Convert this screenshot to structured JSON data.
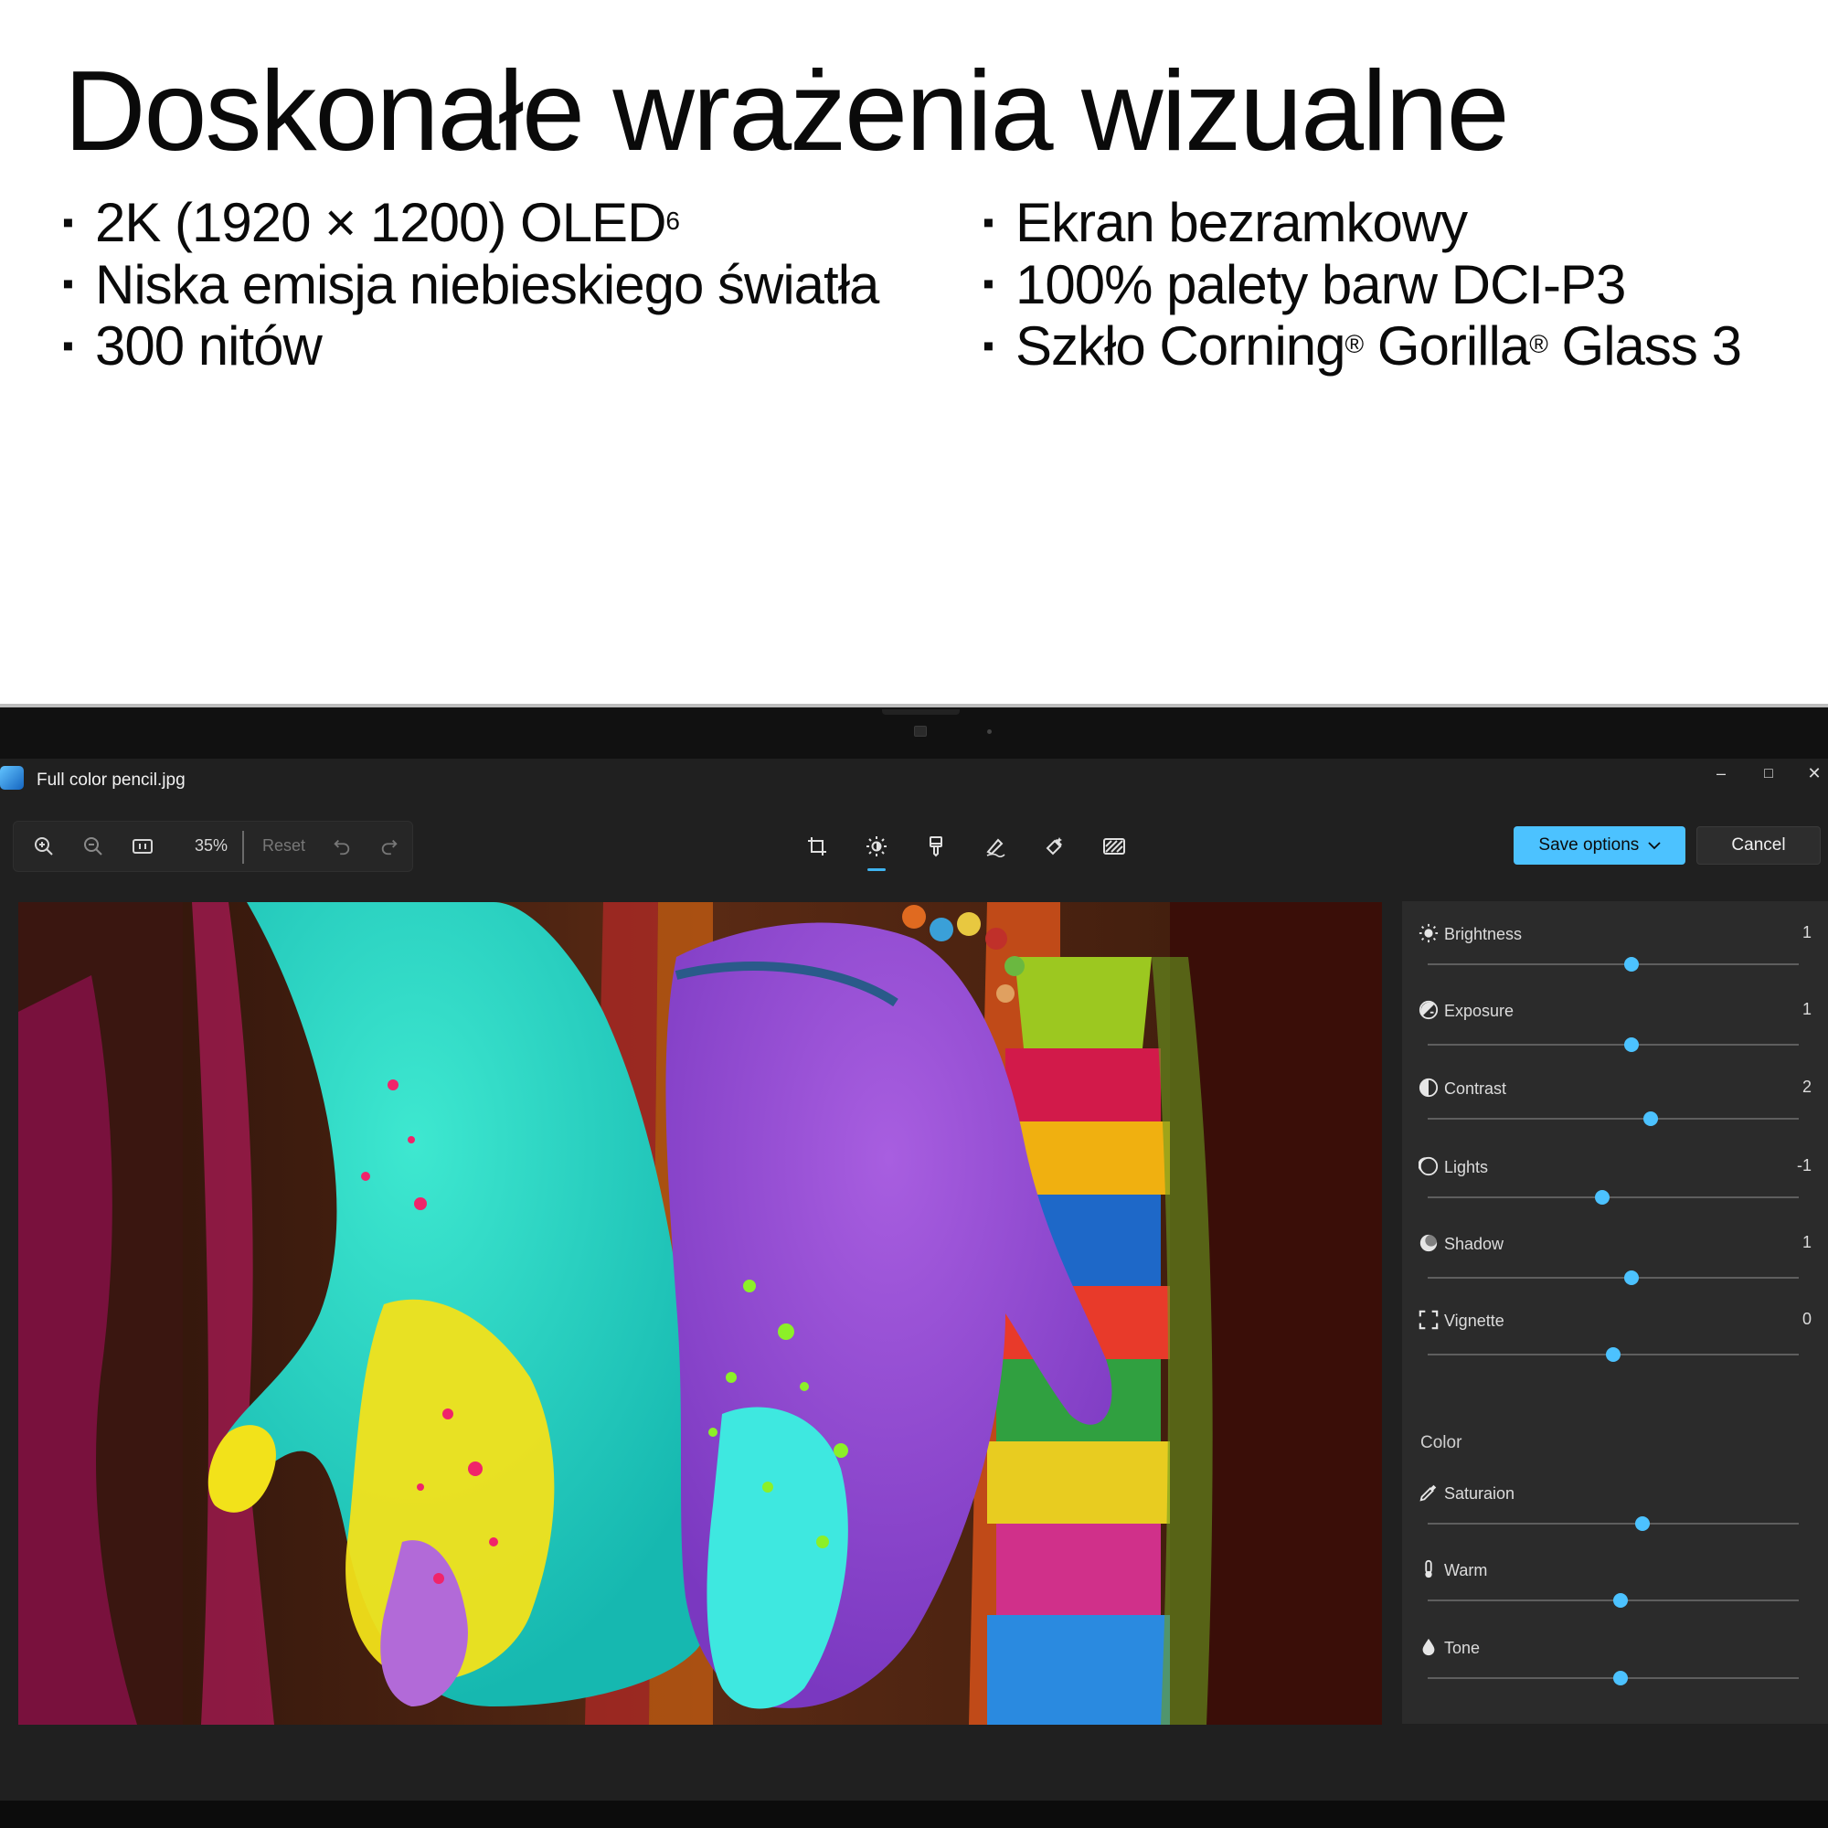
{
  "promo": {
    "headline": "Doskonałe wrażenia wizualne",
    "features_left": [
      "2K (1920 × 1200) OLED",
      "Niska emisja niebieskiego światła",
      "300 nitów"
    ],
    "feature_left_footnote": "6",
    "features_right": [
      "Ekran bezramkowy",
      "100% palety barw DCI-P3"
    ],
    "gorilla": {
      "part1": "Szkło Corning",
      "reg": "®",
      "part2": " Gorilla",
      "part3": " Glass 3"
    }
  },
  "window": {
    "title": "Full color pencil.jpg",
    "controls": {
      "minimize": "–",
      "maximize": "□",
      "close": "✕"
    }
  },
  "toolbar": {
    "zoom": "35%",
    "reset": "Reset",
    "icons": [
      "zoom-in-icon",
      "zoom-out-icon",
      "actual-size-icon",
      "undo-icon",
      "redo-icon"
    ],
    "edit_tools": [
      "crop-icon",
      "adjustment-icon",
      "filter-icon",
      "markup-icon",
      "erase-icon",
      "background-icon"
    ],
    "active_tool": "adjustment-icon"
  },
  "actions": {
    "save": "Save options",
    "cancel": "Cancel"
  },
  "accent_color": "#4cc2ff",
  "adjustments": {
    "light": [
      {
        "label": "Brightness",
        "value": "1",
        "icon": "sun-icon",
        "level": 0.55
      },
      {
        "label": "Exposure",
        "value": "1",
        "icon": "exposure-icon",
        "level": 0.55
      },
      {
        "label": "Contrast",
        "value": "2",
        "icon": "contrast-icon",
        "level": 0.6
      },
      {
        "label": "Lights",
        "value": "-1",
        "icon": "lights-icon",
        "level": 0.47
      },
      {
        "label": "Shadow",
        "value": "1",
        "icon": "shadow-icon",
        "level": 0.55
      },
      {
        "label": "Vignette",
        "value": "0",
        "icon": "vignette-icon",
        "level": 0.5
      }
    ],
    "color_heading": "Color",
    "color": [
      {
        "label": "Saturaion",
        "icon": "eyedropper-icon",
        "level": 0.58
      },
      {
        "label": "Warm",
        "icon": "thermometer-icon",
        "level": 0.52
      },
      {
        "label": "Tone",
        "icon": "drop-icon",
        "level": 0.52
      }
    ]
  }
}
